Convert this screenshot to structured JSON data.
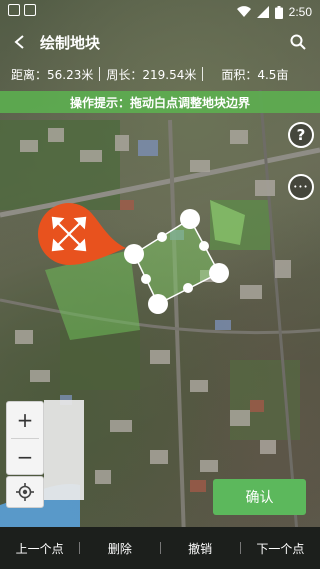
{
  "status_bar": {
    "time": "2:50",
    "icons": [
      "wifi-icon",
      "signal-icon",
      "battery-icon"
    ]
  },
  "header": {
    "title": "绘制地块"
  },
  "stats": {
    "distance": "距离：56.23米",
    "perimeter": "周长：219.54米",
    "area": "面积：4.5亩"
  },
  "hint": {
    "text": "操作提示：拖动白点调整地块边界"
  },
  "side_buttons": {
    "help_symbol": "?",
    "more_symbol": "•••"
  },
  "zoom": {
    "zoom_in": "+",
    "zoom_out": "−"
  },
  "confirm": {
    "label": "确认"
  },
  "toolbar": {
    "items": [
      "上一个点",
      "删除",
      "撤销",
      "下一个点"
    ]
  },
  "colors": {
    "accent_green": "#5cb85c",
    "hint_green": "#5cb050",
    "pin_orange": "#e8521e",
    "polygon_fill": "#86d86a"
  }
}
